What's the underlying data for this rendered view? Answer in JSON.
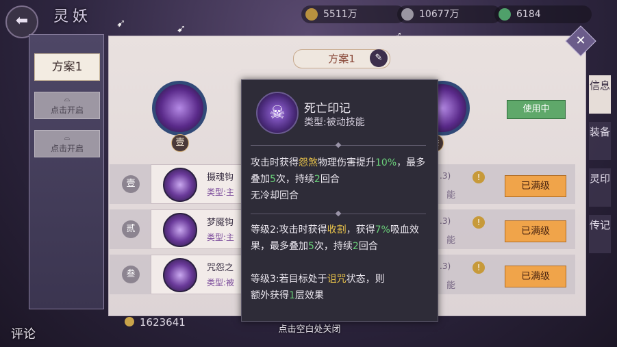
{
  "header": {
    "back_icon": "back-arrow-icon",
    "title": "灵妖",
    "resources": [
      {
        "icon": "copper-coin-icon",
        "value": "5511万",
        "color": "#b8913f"
      },
      {
        "icon": "feather-icon",
        "value": "10677万",
        "color": "#9a96a2"
      },
      {
        "icon": "jade-icon",
        "value": "6184",
        "color": "#4fa06a"
      }
    ]
  },
  "plans": {
    "active_label": "方案1",
    "locked": [
      {
        "label": "点击开启"
      },
      {
        "label": "点击开启"
      }
    ]
  },
  "main": {
    "scheme_label": "方案1",
    "slot_badges": [
      "壹",
      "叁"
    ],
    "in_use_label": "使用中",
    "skills": [
      {
        "num": "壹",
        "name": "摄魂钩",
        "type": "类型:主",
        "lv_text": ".3)",
        "side_text": "能",
        "max_label": "已满级"
      },
      {
        "num": "贰",
        "name": "梦魇钩",
        "type": "类型:主",
        "lv_text": ".3)",
        "side_text": "能",
        "max_label": "已满级"
      },
      {
        "num": "叁",
        "name": "咒怨之",
        "type": "类型:被",
        "lv_text": ".3)",
        "side_text": "能",
        "max_label": "已满级"
      }
    ]
  },
  "right_tabs": [
    {
      "label": "信息",
      "active": true
    },
    {
      "label": "装备",
      "active": false
    },
    {
      "label": "灵印",
      "active": false
    },
    {
      "label": "传记",
      "active": false
    }
  ],
  "bottom": {
    "coins": "1623641",
    "close_hint": "点击空白处关闭",
    "comment_label": "评论"
  },
  "tooltip": {
    "icon": "skull-icon",
    "title": "死亡印记",
    "type": "类型:被动技能",
    "lines": {
      "l1a": "攻击时获得",
      "l1b": "怨煞",
      "l1c": "物理伤害提升",
      "l1d": "10%",
      "l1e": "，最多叠加",
      "l1f": "5",
      "l1g": "次，持续",
      "l1h": "2",
      "l1i": "回合",
      "l1j": "无冷却回合",
      "l2a": "等级2:攻击时获得",
      "l2b": "收割",
      "l2c": "，获得",
      "l2d": "7%",
      "l2e": "吸血效果，最多叠加",
      "l2f": "5",
      "l2g": "次，持续",
      "l2h": "2",
      "l2i": "回合",
      "l3a": "等级3:若目标处于",
      "l3b": "诅咒",
      "l3c": "状态，则",
      "l3d": "额外获得",
      "l3e": "1",
      "l3f": "层效果"
    }
  }
}
